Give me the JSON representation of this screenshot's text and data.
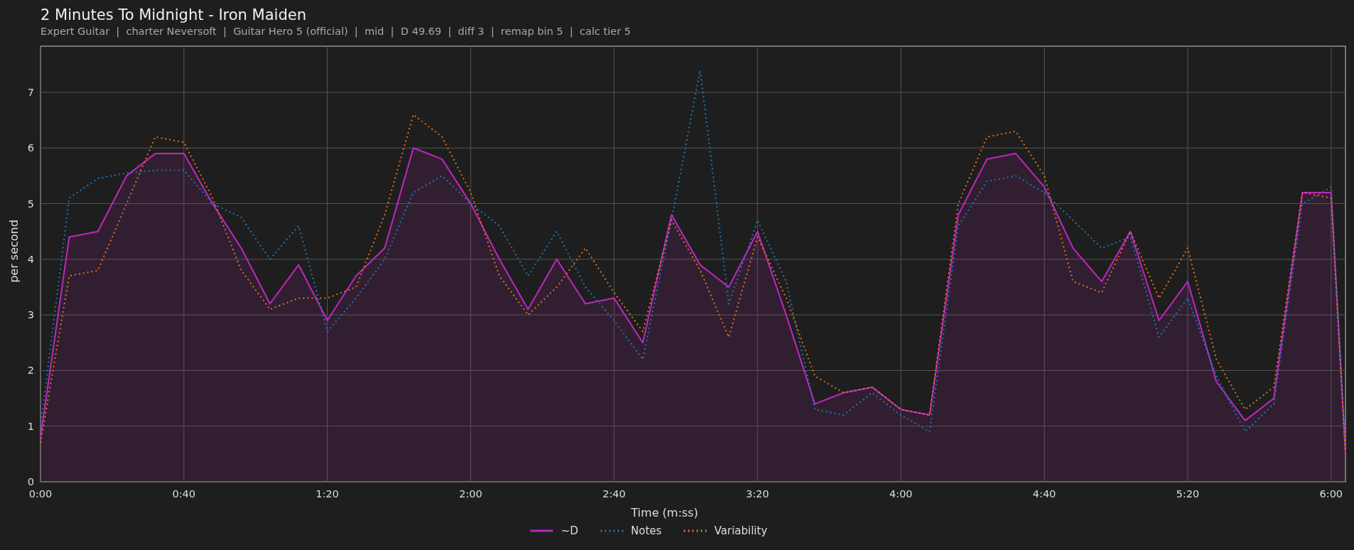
{
  "title": "2 Minutes To Midnight - Iron Maiden",
  "subtitle": "Expert Guitar  |  charter Neversoft  |  Guitar Hero 5 (official)  |  mid  |  D 49.69  |  diff 3  |  remap bin 5  |  calc tier 5",
  "chart_data": {
    "type": "line",
    "grid": true,
    "xlabel": "Time (m:ss)",
    "ylabel": "per second",
    "x": [
      0,
      8,
      16,
      24,
      32,
      40,
      48,
      56,
      64,
      72,
      80,
      88,
      96,
      104,
      112,
      120,
      128,
      136,
      144,
      152,
      160,
      168,
      176,
      184,
      192,
      200,
      208,
      216,
      224,
      232,
      240,
      248,
      256,
      264,
      272,
      280,
      288,
      296,
      304,
      312,
      320,
      328,
      336,
      344,
      352,
      360,
      364
    ],
    "series": [
      {
        "name": "~D",
        "color": "#c026c0",
        "line_style": "solid",
        "type": "area",
        "values": [
          0.8,
          4.4,
          4.5,
          5.5,
          5.9,
          5.9,
          5.0,
          4.2,
          3.2,
          3.9,
          2.9,
          3.7,
          4.2,
          6.0,
          5.8,
          5.0,
          4.0,
          3.1,
          4.0,
          3.2,
          3.3,
          2.5,
          4.8,
          3.9,
          3.5,
          4.5,
          3.0,
          1.4,
          1.6,
          1.7,
          1.3,
          1.2,
          4.8,
          5.8,
          5.9,
          5.3,
          4.2,
          3.6,
          4.5,
          2.9,
          3.6,
          1.8,
          1.1,
          1.5,
          5.2,
          5.2,
          0.5
        ]
      },
      {
        "name": "Notes",
        "color": "#1f77b4",
        "line_style": "dotted",
        "type": "line",
        "values": [
          1.0,
          5.1,
          5.45,
          5.55,
          5.6,
          5.6,
          5.0,
          4.75,
          4.0,
          4.6,
          2.7,
          3.3,
          4.0,
          5.2,
          5.5,
          5.0,
          4.6,
          3.7,
          4.5,
          3.5,
          2.9,
          2.2,
          4.7,
          7.4,
          3.2,
          4.7,
          3.6,
          1.3,
          1.2,
          1.6,
          1.2,
          0.9,
          4.6,
          5.4,
          5.5,
          5.2,
          4.7,
          4.2,
          4.4,
          2.6,
          3.3,
          1.9,
          0.9,
          1.4,
          5.0,
          5.3,
          0.6
        ]
      },
      {
        "name": "Variability",
        "color": "#e07020",
        "line_style": "dotted",
        "type": "line",
        "values": [
          0.7,
          3.7,
          3.8,
          5.0,
          6.2,
          6.1,
          5.1,
          3.8,
          3.1,
          3.3,
          3.3,
          3.5,
          4.8,
          6.6,
          6.2,
          5.2,
          3.7,
          3.0,
          3.5,
          4.2,
          3.4,
          2.7,
          4.7,
          3.8,
          2.6,
          4.4,
          3.3,
          1.9,
          1.6,
          1.7,
          1.3,
          1.2,
          5.0,
          6.2,
          6.3,
          5.5,
          3.6,
          3.4,
          4.5,
          3.3,
          4.2,
          2.2,
          1.3,
          1.7,
          5.2,
          5.1,
          0.5
        ]
      }
    ],
    "xlim": [
      0,
      364
    ],
    "ylim": [
      0,
      7.83
    ],
    "xticks": [
      {
        "value": 0,
        "label": "0:00"
      },
      {
        "value": 40,
        "label": "0:40"
      },
      {
        "value": 80,
        "label": "1:20"
      },
      {
        "value": 120,
        "label": "2:00"
      },
      {
        "value": 160,
        "label": "2:40"
      },
      {
        "value": 200,
        "label": "3:20"
      },
      {
        "value": 240,
        "label": "4:00"
      },
      {
        "value": 280,
        "label": "4:40"
      },
      {
        "value": 320,
        "label": "5:20"
      },
      {
        "value": 360,
        "label": "6:00"
      }
    ],
    "yticks": [
      0,
      1,
      2,
      3,
      4,
      5,
      6,
      7
    ]
  }
}
